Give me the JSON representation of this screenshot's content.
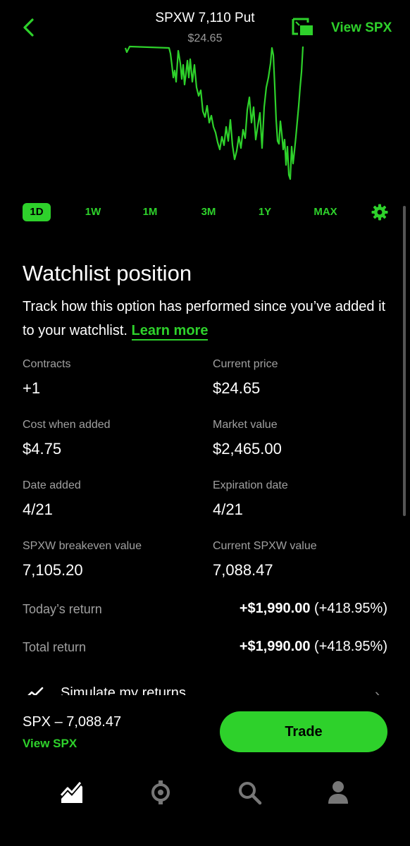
{
  "header": {
    "title": "SPXW 7,110 Put",
    "price": "$24.65",
    "view_link": "View SPX",
    "back_icon": "chevron-left-icon",
    "pip_icon": "picture-in-picture-icon"
  },
  "colors": {
    "accent": "#2ed12b",
    "background": "#000000",
    "muted_text": "#a0a0a0"
  },
  "chart_ranges": [
    "1D",
    "1W",
    "1M",
    "3M",
    "1Y",
    "MAX"
  ],
  "active_range": "1D",
  "watchlist": {
    "title": "Watchlist position",
    "description": "Track how this option has performed since you’ve added it to your watchlist.",
    "learn_more": "Learn more",
    "stats": [
      {
        "label": "Contracts",
        "value": "+1"
      },
      {
        "label": "Current price",
        "value": "$24.65"
      },
      {
        "label": "Cost when added",
        "value": "$4.75"
      },
      {
        "label": "Market value",
        "value": "$2,465.00"
      },
      {
        "label": "Date added",
        "value": "4/21"
      },
      {
        "label": "Expiration date",
        "value": "4/21"
      },
      {
        "label": "SPXW breakeven value",
        "value": "7,105.20"
      },
      {
        "label": "Current SPXW value",
        "value": "7,088.47"
      }
    ],
    "returns": [
      {
        "label": "Today’s return",
        "amount": "+$1,990.00",
        "percent": "(+418.95%)"
      },
      {
        "label": "Total return",
        "amount": "+$1,990.00",
        "percent": "(+418.95%)"
      }
    ],
    "simulate_label": "Simulate my returns"
  },
  "footer": {
    "price_text": "SPX – 7,088.47",
    "view_link": "View SPX",
    "trade_label": "Trade"
  },
  "tabs": [
    {
      "name": "investing-tab",
      "icon": "chart-icon"
    },
    {
      "name": "crypto-tab",
      "icon": "crypto-coin-icon"
    },
    {
      "name": "search-tab",
      "icon": "search-icon"
    },
    {
      "name": "account-tab",
      "icon": "person-icon"
    }
  ]
}
